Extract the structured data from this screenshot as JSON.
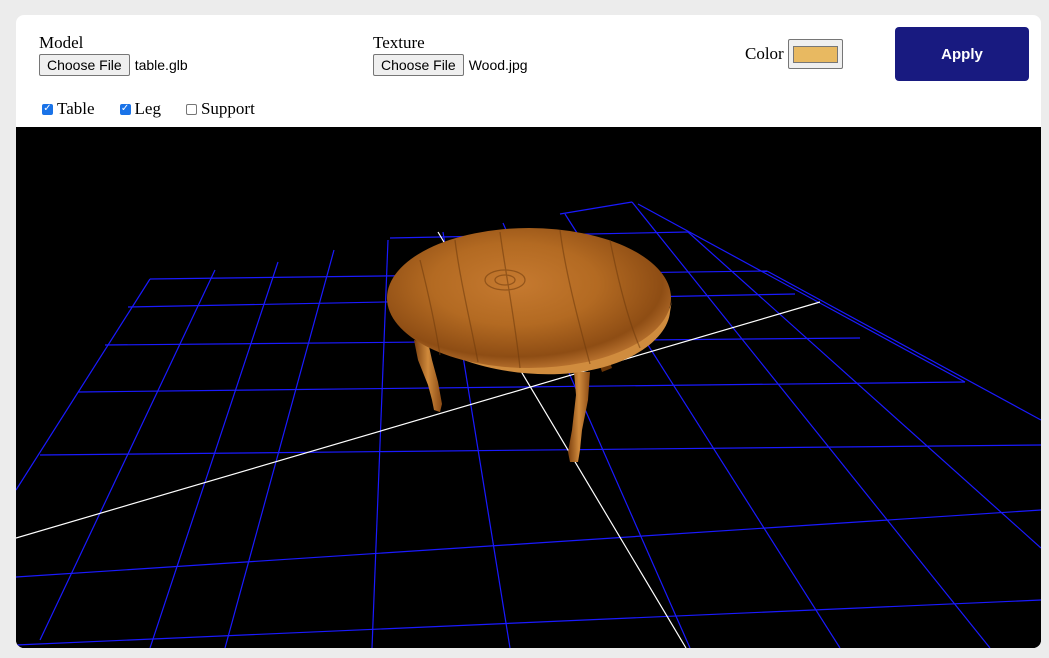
{
  "model": {
    "label": "Model",
    "button": "Choose File",
    "file_name": "table.glb"
  },
  "texture": {
    "label": "Texture",
    "button": "Choose File",
    "file_name": "Wood.jpg"
  },
  "color": {
    "label": "Color",
    "value": "#e8b961"
  },
  "apply": {
    "label": "Apply"
  },
  "checkboxes": [
    {
      "label": "Table",
      "checked": true
    },
    {
      "label": "Leg",
      "checked": true
    },
    {
      "label": "Support",
      "checked": false
    }
  ],
  "viewport": {
    "background": "#000000",
    "grid_color": "#1a1aff",
    "axis_color": "#ffffff",
    "wood_color": "#b8702a"
  }
}
